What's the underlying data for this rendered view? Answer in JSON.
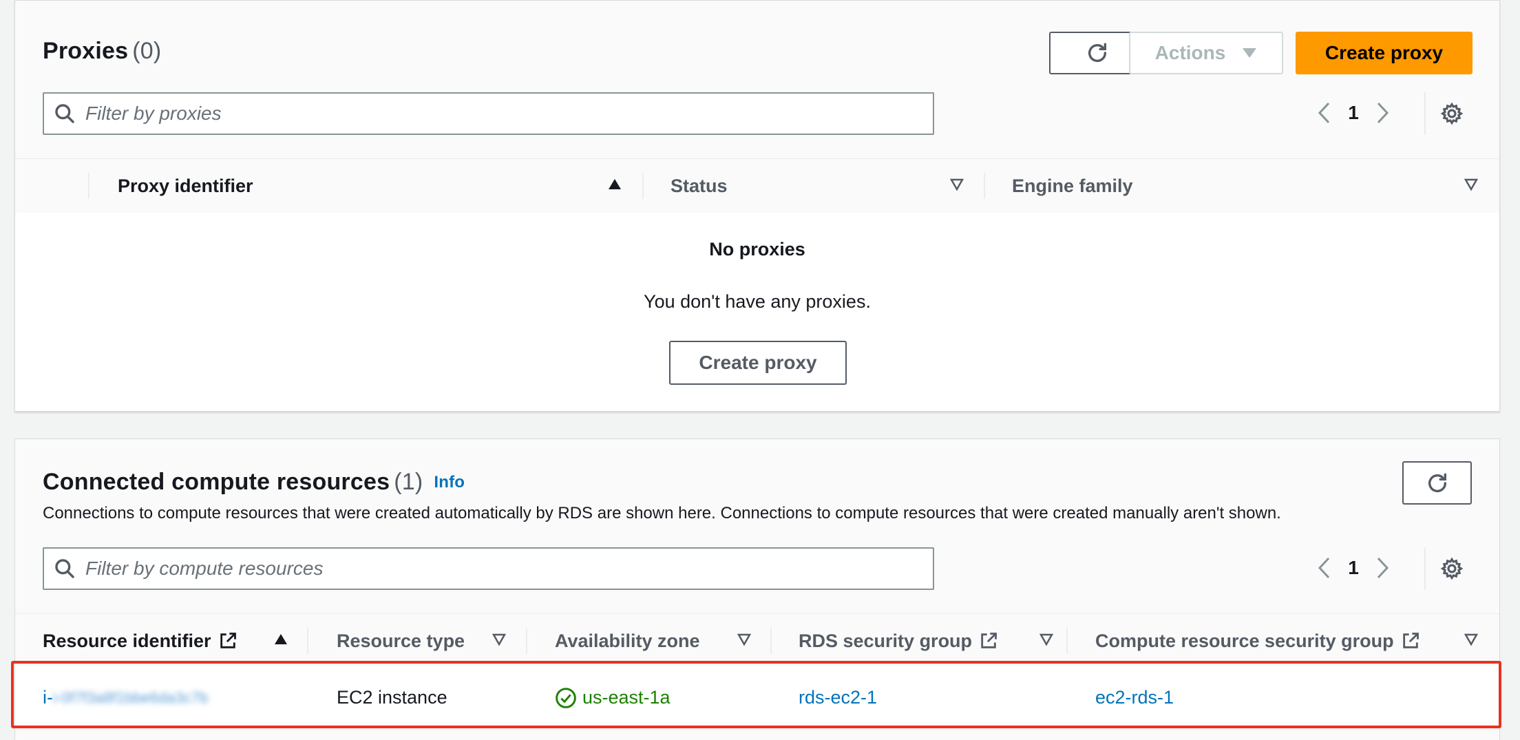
{
  "proxies": {
    "title": "Proxies",
    "count": "(0)",
    "refresh_icon": "refresh-icon",
    "actions_label": "Actions",
    "create_label": "Create proxy",
    "search_placeholder": "Filter by proxies",
    "page": "1",
    "columns": [
      {
        "label": "Proxy identifier",
        "sort": "ascending"
      },
      {
        "label": "Status",
        "sort": "none"
      },
      {
        "label": "Engine family",
        "sort": "none"
      }
    ],
    "empty_title": "No proxies",
    "empty_desc": "You don't have any proxies.",
    "empty_create_label": "Create proxy"
  },
  "compute": {
    "title": "Connected compute resources",
    "count": "(1)",
    "info_label": "Info",
    "description": "Connections to compute resources that were created automatically by RDS are shown here. Connections to compute resources that were created manually aren't shown.",
    "search_placeholder": "Filter by compute resources",
    "page": "1",
    "columns": [
      {
        "label": "Resource identifier",
        "external": true,
        "sort": "ascending"
      },
      {
        "label": "Resource type",
        "external": false,
        "sort": "none"
      },
      {
        "label": "Availability zone",
        "external": false,
        "sort": "none"
      },
      {
        "label": "RDS security group",
        "external": true,
        "sort": "none"
      },
      {
        "label": "Compute resource security group",
        "external": true,
        "sort": "none"
      }
    ],
    "rows": [
      {
        "resource_identifier": "i-0f7f3a8f1bbe6da3c7b",
        "resource_type": "EC2 instance",
        "availability_zone": "us-east-1a",
        "rds_security_group": "rds-ec2-1",
        "compute_security_group": "ec2-rds-1"
      }
    ]
  },
  "colors": {
    "primary": "#ff9900",
    "link": "#0073bb",
    "success": "#1d8102",
    "highlight": "#e8321f"
  }
}
